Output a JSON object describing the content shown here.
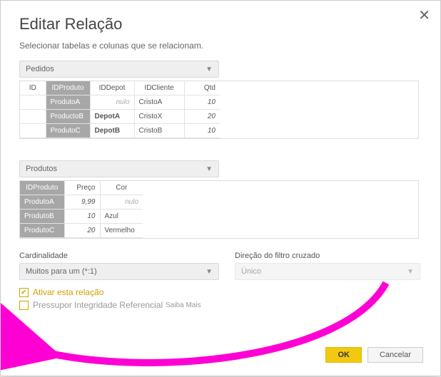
{
  "close_symbol": "✕",
  "title": "Editar Relação",
  "subtitle": "Selecionar tabelas e colunas que se relacionam.",
  "table1_select": {
    "label": "Pedidos"
  },
  "table1": {
    "headers": [
      "ID",
      "IDProduto",
      "IDDepot",
      "IDCliente",
      "Qtd"
    ],
    "selected_header_index": 1,
    "rows": [
      {
        "head": "ProdutoA",
        "c2": "nulo",
        "c3": "CristoA",
        "c4": "10"
      },
      {
        "head": "ProductoB",
        "c2": "DepotA",
        "c3": "CristoX",
        "c4": "20"
      },
      {
        "head": "ProdutoC",
        "c2": "DepotB",
        "c3": "CristoB",
        "c4": "10"
      }
    ]
  },
  "table2_select": {
    "label": "Produtos"
  },
  "table2": {
    "headers": [
      "IDProduto",
      "Preço",
      "Cor"
    ],
    "selected_header_index": 0,
    "rows": [
      {
        "head": "ProdutoA",
        "c1": "9,99",
        "c2": "nulo"
      },
      {
        "head": "ProdutoB",
        "c1": "10",
        "c2": "Azul"
      },
      {
        "head": "ProdutoC",
        "c1": "20",
        "c2": "Vermelho"
      }
    ]
  },
  "cardinality": {
    "label": "Cardinalidade",
    "value": "Muitos para um (*:1)"
  },
  "crossfilter": {
    "label": "Direção do filtro cruzado",
    "value": "Único"
  },
  "check1": {
    "label": "Ativar esta relação",
    "checked": true
  },
  "check2": {
    "label": "Pressupor Integridade Referencial",
    "extra": "Saiba Mais",
    "checked": false
  },
  "buttons": {
    "ok": "OK",
    "cancel": "Cancelar"
  }
}
